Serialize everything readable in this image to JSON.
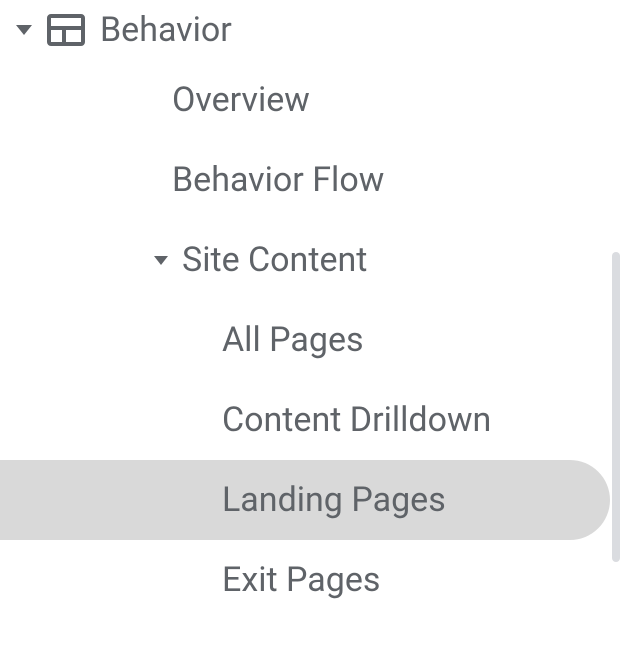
{
  "nav": {
    "section": {
      "label": "Behavior",
      "expanded": true
    },
    "items": [
      {
        "label": "Overview",
        "type": "item"
      },
      {
        "label": "Behavior Flow",
        "type": "item"
      },
      {
        "label": "Site Content",
        "type": "subsection",
        "expanded": true,
        "children": [
          {
            "label": "All Pages",
            "selected": false
          },
          {
            "label": "Content Drilldown",
            "selected": false
          },
          {
            "label": "Landing Pages",
            "selected": true
          },
          {
            "label": "Exit Pages",
            "selected": false
          }
        ]
      }
    ]
  }
}
